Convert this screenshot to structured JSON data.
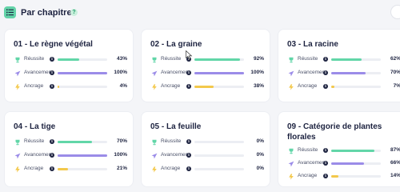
{
  "header": {
    "title": "Par chapitres",
    "help_label": "?"
  },
  "metric_labels": {
    "reussite": "Réussite",
    "avancement": "Avancement",
    "ancrage": "Ancrage",
    "info": "i"
  },
  "colors": {
    "reussite": "#62d6a8",
    "avancement": "#9b8ce8",
    "ancrage": "#f3c84b",
    "accent": "#63d3a8"
  },
  "chapters": [
    {
      "title": "01 - Le règne végétal",
      "reussite": {
        "value": 43,
        "text": "43%"
      },
      "avancement": {
        "value": 100,
        "text": "100%"
      },
      "ancrage": {
        "value": 4,
        "text": "4%"
      }
    },
    {
      "title": "02 - La graine",
      "reussite": {
        "value": 92,
        "text": "92%"
      },
      "avancement": {
        "value": 100,
        "text": "100%"
      },
      "ancrage": {
        "value": 38,
        "text": "38%"
      }
    },
    {
      "title": "03 - La racine",
      "reussite": {
        "value": 62,
        "text": "62%"
      },
      "avancement": {
        "value": 70,
        "text": "70%"
      },
      "ancrage": {
        "value": 7,
        "text": "7%"
      }
    },
    {
      "title": "04 - La tige",
      "reussite": {
        "value": 70,
        "text": "70%"
      },
      "avancement": {
        "value": 100,
        "text": "100%"
      },
      "ancrage": {
        "value": 21,
        "text": "21%"
      }
    },
    {
      "title": "05 - La feuille",
      "reussite": {
        "value": 0,
        "text": "0%"
      },
      "avancement": {
        "value": 0,
        "text": "0%"
      },
      "ancrage": {
        "value": 0,
        "text": "0%"
      }
    },
    {
      "title": "09 - Catégorie de plantes florales",
      "reussite": {
        "value": 87,
        "text": "87%"
      },
      "avancement": {
        "value": 66,
        "text": "66%"
      },
      "ancrage": {
        "value": 14,
        "text": "14%"
      }
    }
  ]
}
